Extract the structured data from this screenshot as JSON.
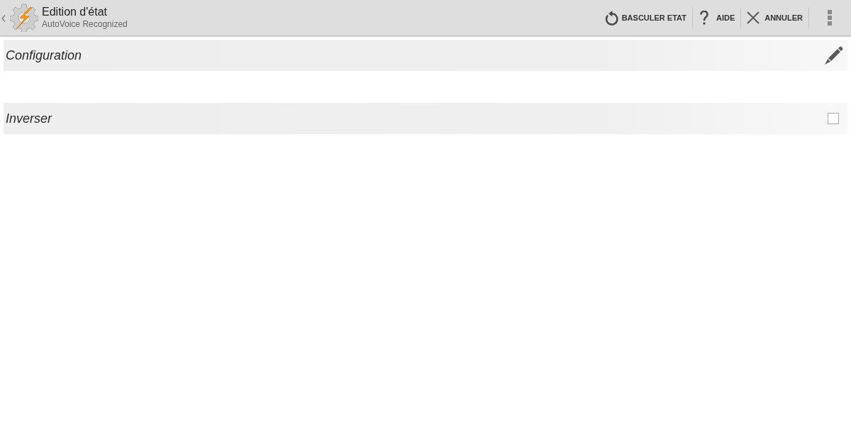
{
  "action_bar": {
    "title": "Edition d'état",
    "subtitle": "AutoVoice Recognized",
    "actions": [
      {
        "kind": "toggle",
        "label": "BASCULER ETAT"
      },
      {
        "kind": "help",
        "label": "AIDE"
      },
      {
        "kind": "cancel",
        "label": "ANNULER"
      }
    ]
  },
  "settings": [
    {
      "kind": "edit",
      "label": "Configuration"
    },
    {
      "kind": "checkbox",
      "label": "Inverser",
      "checked": false
    }
  ]
}
